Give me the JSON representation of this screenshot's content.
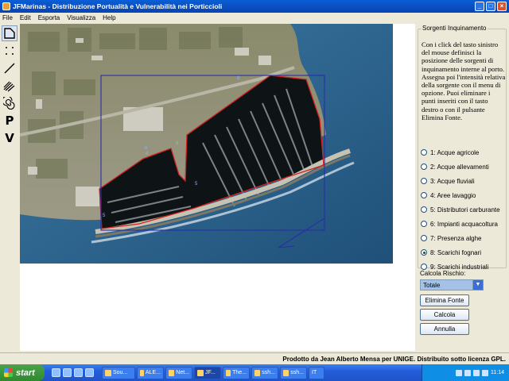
{
  "window": {
    "title": "JFMarinas - Distribuzione Portualità e Vulnerabilità nei Porticcioli"
  },
  "menu": [
    "File",
    "Edit",
    "Esporta",
    "Visualizza",
    "Help"
  ],
  "tools": [
    {
      "name": "polygon-tool-icon",
      "kind": "svg"
    },
    {
      "name": "points-tool-icon",
      "kind": "svg"
    },
    {
      "name": "line-tool-icon",
      "kind": "svg"
    },
    {
      "name": "multiline-tool-icon",
      "kind": "svg"
    },
    {
      "name": "spiral-tool-icon",
      "kind": "svg"
    },
    {
      "name": "p-tool-icon",
      "kind": "letter",
      "letter": "P"
    },
    {
      "name": "v-tool-icon",
      "kind": "letter",
      "letter": "V"
    }
  ],
  "map": {
    "labels": [
      "8",
      "6",
      "8",
      "5",
      "5",
      "4"
    ]
  },
  "panel": {
    "group_title": "Sorgenti Inquinamento",
    "instructions": "Con i click del tasto sinistro del mouse definisci la posizione delle sorgenti di inquinamento interne al porto. Assegna poi l'intensità relativa della sorgente con il menu di opzione. Puoi eliminare i punti inseriti con il tasto destro o con il pulsante Elimina Fonte.",
    "sources": [
      {
        "label": "1: Acque agricole",
        "checked": false
      },
      {
        "label": "2: Acque allevamenti",
        "checked": false
      },
      {
        "label": "3: Acque fluviali",
        "checked": false
      },
      {
        "label": "4: Aree lavaggio",
        "checked": false
      },
      {
        "label": "5: Distributori carburante",
        "checked": false
      },
      {
        "label": "6: Impianti acquacoltura",
        "checked": false
      },
      {
        "label": "7: Presenza alghe",
        "checked": false
      },
      {
        "label": "8: Scarichi fognari",
        "checked": true
      },
      {
        "label": "9: Scarichi industriali",
        "checked": false
      }
    ],
    "calc_label": "Calcola Rischio:",
    "calc_select": "Totale",
    "buttons": {
      "remove": "Elimina Fonte",
      "calc": "Calcola",
      "cancel": "Annulla"
    }
  },
  "status": {
    "credit": "Prodotto da Jean Alberto Mensa per UNIGE. Distribuito sotto licenza GPL."
  },
  "taskbar": {
    "start": "start",
    "tasks": [
      "Sou...",
      "ALE...",
      "Net...",
      "JF...",
      "The...",
      "ssh...",
      "ssh...",
      "IT"
    ],
    "clock": "11:14"
  },
  "colors": {
    "sea": "#2a5f88",
    "harbour_water": "#0e1416",
    "red_outline": "#d42020",
    "blue_outline": "#2c2ca8",
    "titlebar": "#0a4fc0"
  }
}
